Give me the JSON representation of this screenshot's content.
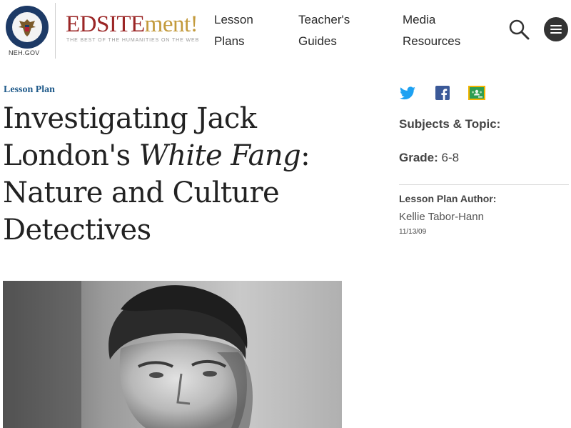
{
  "header": {
    "neh_label": "NEH.GOV",
    "brand_part1": "EDSITE",
    "brand_part2": "ment!",
    "tagline": "THE BEST OF THE HUMANITIES ON THE WEB",
    "nav": [
      {
        "line1": "Lesson",
        "line2": "Plans"
      },
      {
        "line1": "Teacher's",
        "line2": "Guides"
      },
      {
        "line1": "Media",
        "line2": "Resources"
      }
    ]
  },
  "article": {
    "eyebrow": "Lesson Plan",
    "title_part1": "Investigating Jack London's ",
    "title_italic": "White Fang",
    "title_part2": ": Nature and Culture Detectives"
  },
  "sidebar": {
    "subjects_label": "Subjects & Topic:",
    "grade_label": "Grade:",
    "grade_value": "6-8",
    "author_label": "Lesson Plan Author:",
    "author_name": "Kellie Tabor-Hann",
    "date": "11/13/09"
  },
  "colors": {
    "brand_red": "#9b2626",
    "brand_gold": "#c39a3c",
    "eyebrow_blue": "#1f5a8a",
    "twitter": "#1da1f2",
    "facebook": "#3b5998",
    "classroom": "#2e9e52"
  },
  "icons": [
    "search-icon",
    "menu-icon",
    "twitter-icon",
    "facebook-icon",
    "google-classroom-icon"
  ]
}
